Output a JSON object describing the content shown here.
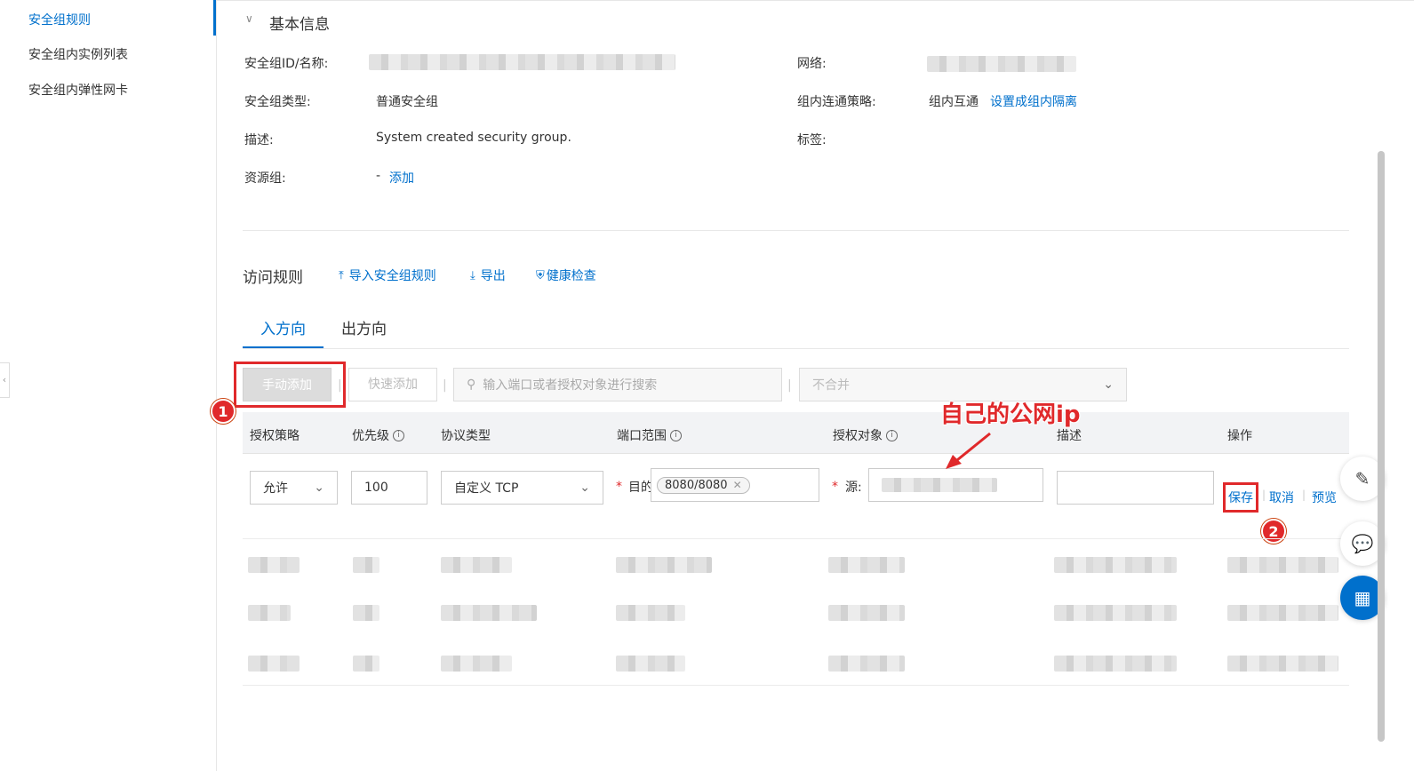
{
  "sidebar": {
    "items": [
      {
        "label": "安全组规则",
        "active": true
      },
      {
        "label": "安全组内实例列表",
        "active": false
      },
      {
        "label": "安全组内弹性网卡",
        "active": false
      }
    ]
  },
  "basic_info": {
    "title": "基本信息",
    "id_name_label": "安全组ID/名称:",
    "network_label": "网络:",
    "type_label": "安全组类型:",
    "type_value": "普通安全组",
    "policy_label": "组内连通策略:",
    "policy_value": "组内互通",
    "policy_link": "设置成组内隔离",
    "desc_label": "描述:",
    "desc_value": "System created security group.",
    "tag_label": "标签:",
    "resource_label": "资源组:",
    "resource_value": "-",
    "resource_link": "添加"
  },
  "rules": {
    "title": "访问规则",
    "import_label": "导入安全组规则",
    "export_label": "导出",
    "health_label": "健康检查",
    "tabs": [
      {
        "label": "入方向",
        "active": true
      },
      {
        "label": "出方向",
        "active": false
      }
    ],
    "manual_add": "手动添加",
    "quick_add": "快速添加",
    "search_placeholder": "输入端口或者授权对象进行搜索",
    "merge_select": "不合并",
    "columns": [
      "授权策略",
      "优先级",
      "协议类型",
      "端口范围",
      "授权对象",
      "描述",
      "操作"
    ],
    "edit_row": {
      "policy": "允许",
      "priority": "100",
      "protocol": "自定义 TCP",
      "dest_label": "目的",
      "port_tag": "8080/8080",
      "source_label": "源:",
      "actions": [
        "保存",
        "取消",
        "预览"
      ]
    }
  },
  "annotations": {
    "public_ip_note": "自己的公网ip",
    "step1": "1",
    "step2": "2"
  },
  "colors": {
    "accent": "#0070cc",
    "highlight": "#e0292b"
  }
}
